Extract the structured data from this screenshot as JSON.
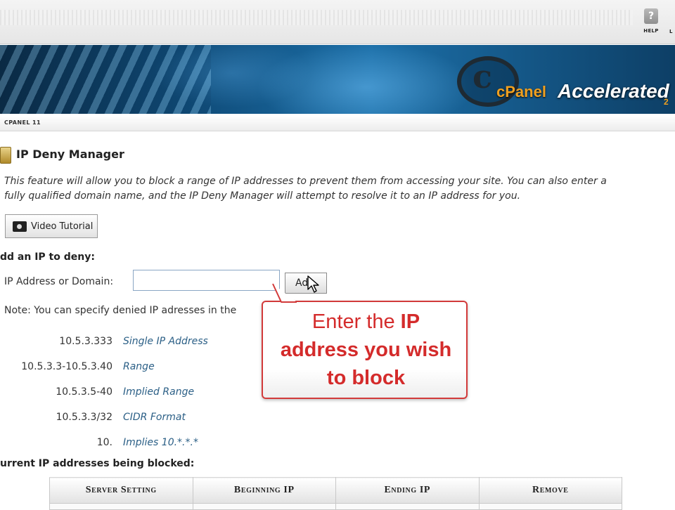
{
  "topbar": {
    "help_label": "HELP",
    "logout_label": "L"
  },
  "banner": {
    "brand_cpanel": "cPanel",
    "brand_accelerated": "Accelerated",
    "brand_version": "2"
  },
  "breadcrumb": "CPANEL 11",
  "page": {
    "title": "IP Deny Manager",
    "description_line1": "This feature will allow you to block a range of IP addresses to prevent them from accessing your site. You can also enter a",
    "description_line2": "fully qualified domain name, and the IP Deny Manager will attempt to resolve it to an IP address for you.",
    "video_button": "Video Tutorial"
  },
  "add_section": {
    "heading": "dd an IP to deny:",
    "field_label": "IP Address or Domain:",
    "input_value": "",
    "add_button": "Ad",
    "note": "Note: You can specify denied IP adresses in the"
  },
  "examples": [
    {
      "value": "10.5.3.333",
      "desc": "Single IP Address"
    },
    {
      "value": "10.5.3.3-10.5.3.40",
      "desc": "Range"
    },
    {
      "value": "10.5.3.5-40",
      "desc": "Implied Range"
    },
    {
      "value": "10.5.3.3/32",
      "desc": "CIDR Format"
    },
    {
      "value": "10.",
      "desc": "Implies 10.*.*.*"
    }
  ],
  "callout": {
    "line1_a": "Enter the",
    "line1_b": "IP",
    "line2": "address you wish",
    "line3": "to block"
  },
  "blocked": {
    "heading": "urrent IP addresses being blocked:",
    "columns": [
      "Server Setting",
      "Beginning IP",
      "Ending IP",
      "Remove"
    ]
  },
  "colors": {
    "callout_red": "#d42b2b",
    "link_blue": "#2b5f86",
    "banner_blue": "#0f4b78"
  }
}
